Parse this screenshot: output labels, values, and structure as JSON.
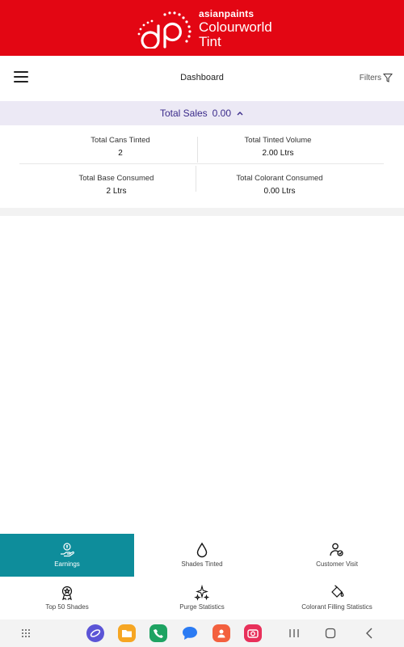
{
  "brand": {
    "line1": "asianpaints",
    "line2": "Colourworld",
    "line3": "Tint",
    "color": "#e30613"
  },
  "appbar": {
    "title": "Dashboard",
    "filters_label": "Filters",
    "menu_icon": "hamburger-menu-icon",
    "filter_icon": "filter-funnel-icon"
  },
  "sales": {
    "label": "Total Sales",
    "value": "0.00",
    "icon": "chevron-up-icon"
  },
  "stats": [
    {
      "label": "Total Cans Tinted",
      "value": "2"
    },
    {
      "label": "Total Tinted Volume",
      "value": "2.00 Ltrs"
    },
    {
      "label": "Total Base Consumed",
      "value": "2 Ltrs"
    },
    {
      "label": "Total Colorant Consumed",
      "value": "0.00 Ltrs"
    }
  ],
  "tiles": [
    {
      "label": "Earnings",
      "icon": "earnings-hand-icon",
      "active": true
    },
    {
      "label": "Shades Tinted",
      "icon": "drop-icon",
      "active": false
    },
    {
      "label": "Customer Visit",
      "icon": "customer-visit-icon",
      "active": false
    },
    {
      "label": "Top 50 Shades",
      "icon": "award-badge-icon",
      "active": false
    },
    {
      "label": "Purge Statistics",
      "icon": "sparkle-icon",
      "active": false
    },
    {
      "label": "Colorant Filling Statistics",
      "icon": "paint-bucket-icon",
      "active": false
    }
  ],
  "colors": {
    "accent_teal": "#0e8d9b",
    "sales_text": "#3a2a8a",
    "sales_bg": "#ece9f5"
  },
  "system_nav": {
    "apps": [
      "internet-browser-icon",
      "my-files-icon",
      "phone-icon",
      "messages-icon",
      "contacts-icon",
      "camera-icon"
    ],
    "buttons": [
      "app-drawer-icon",
      "recents-icon",
      "home-icon",
      "back-icon"
    ]
  }
}
